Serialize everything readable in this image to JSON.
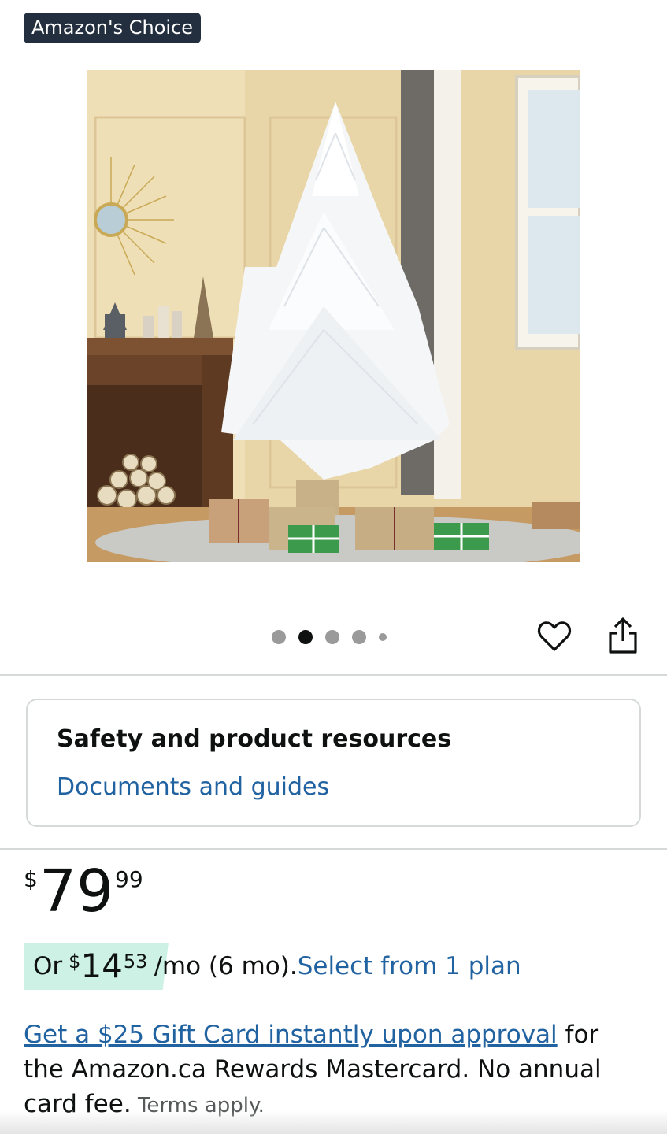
{
  "badge": {
    "label": "Amazon's Choice"
  },
  "gallery": {
    "image_subject": "white artificial Christmas tree with wrapped gifts",
    "dot_count": 5,
    "active_dot": 2
  },
  "actions": {
    "favorite_icon": "heart-icon",
    "share_icon": "share-icon"
  },
  "resources": {
    "title": "Safety and product resources",
    "link": "Documents and guides"
  },
  "price": {
    "symbol": "$",
    "whole": "79",
    "fraction": "99"
  },
  "installment": {
    "prefix": "Or",
    "symbol": "$",
    "whole": "14",
    "fraction": "53",
    "period": "/mo (6 mo).",
    "plan_link": "Select from 1 plan"
  },
  "promo": {
    "link_text": "Get a $25 Gift Card instantly upon approval",
    "body": " for the Amazon.ca Rewards Mastercard. No annual card fee.",
    "terms": " Terms apply."
  },
  "colors": {
    "link": "#2162a1",
    "badge_bg": "#232f3e",
    "installment_highlight": "#cdf2e5",
    "divider": "#d5d9d9"
  }
}
